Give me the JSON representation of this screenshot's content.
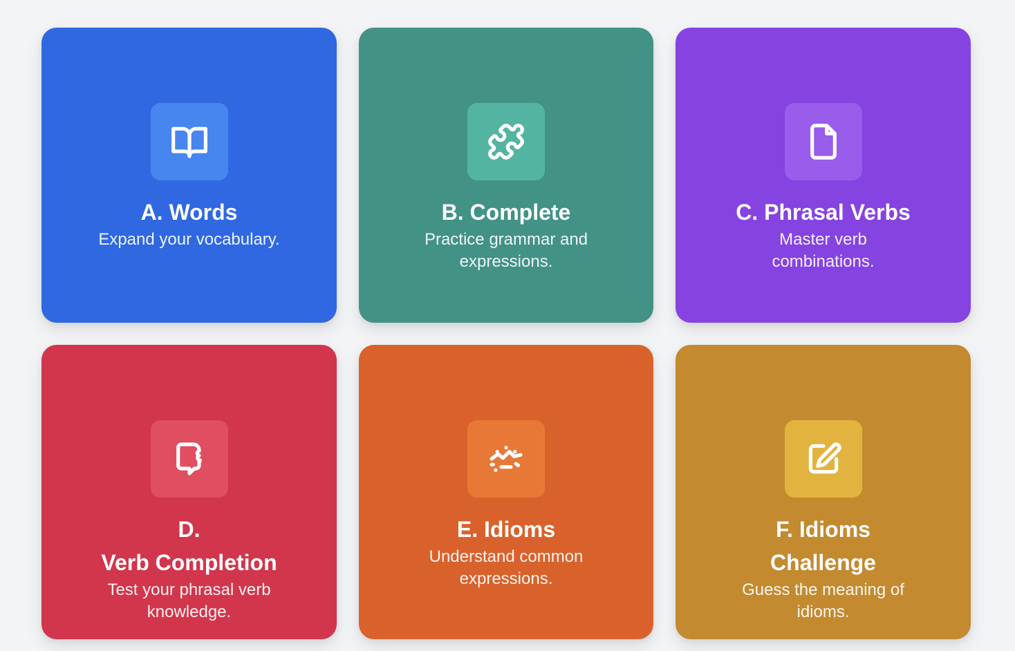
{
  "cards": [
    {
      "title_lines": [
        "A. Words"
      ],
      "description_lines": [
        "Expand your vocabulary."
      ],
      "icon": "book-open-icon",
      "color": "#2f68e1",
      "icon_bg": "#4785ef"
    },
    {
      "title_lines": [
        "B. Complete"
      ],
      "description_lines": [
        "Practice grammar and",
        "expressions."
      ],
      "icon": "puzzle-icon",
      "color": "#429286",
      "icon_bg": "#53b4a2"
    },
    {
      "title_lines": [
        "C. Phrasal Verbs"
      ],
      "description_lines": [
        "Master verb",
        "combinations."
      ],
      "icon": "file-icon",
      "color": "#8543e1",
      "icon_bg": "#9a5ceb"
    },
    {
      "title_lines": [
        "D.",
        "Verb Completion"
      ],
      "description_lines": [
        "Test your phrasal verb",
        "knowledge."
      ],
      "icon": "message-bubble-icon",
      "color": "#d1364c",
      "icon_bg": "#e04e62"
    },
    {
      "title_lines": [
        "E. Idioms"
      ],
      "description_lines": [
        "Understand common",
        "expressions."
      ],
      "icon": "sunrise-icon",
      "color": "#d9622c",
      "icon_bg": "#e87836"
    },
    {
      "title_lines": [
        "F. Idioms",
        "Challenge"
      ],
      "description_lines": [
        "Guess the meaning of",
        "idioms."
      ],
      "icon": "edit-square-icon",
      "color": "#c38a2f",
      "icon_bg": "#e3b33f"
    }
  ]
}
